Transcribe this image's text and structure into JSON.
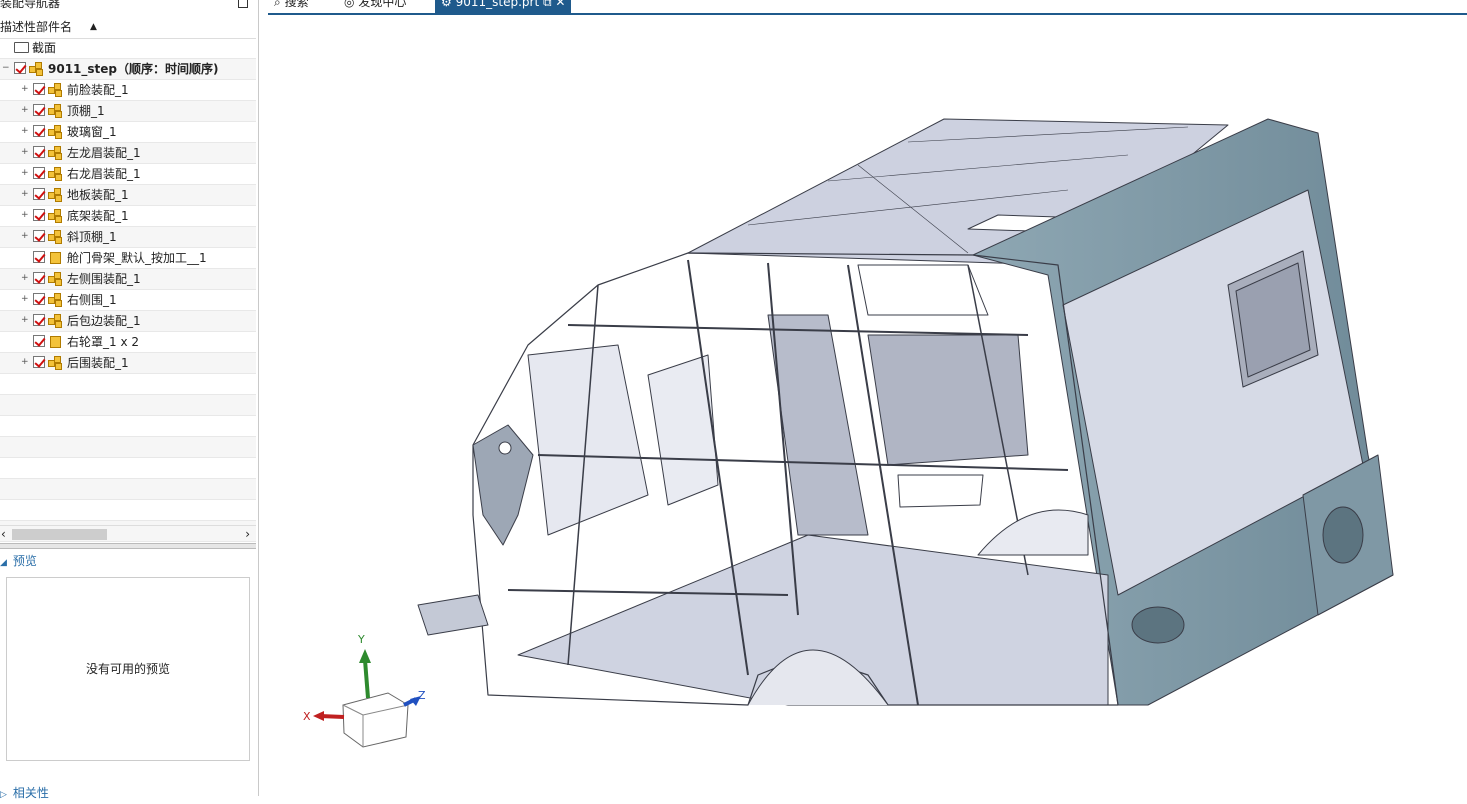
{
  "navigator": {
    "title": "装配导航器",
    "column_header": "描述性部件名",
    "tree": [
      {
        "label": "截面",
        "type": "folder",
        "level": 0
      },
      {
        "label": "9011_step（顺序：时间顺序)",
        "type": "assembly-root",
        "level": 0,
        "bold": true
      },
      {
        "label": "前脸装配_1",
        "type": "assembly",
        "level": 1
      },
      {
        "label": "顶棚_1",
        "type": "assembly",
        "level": 1
      },
      {
        "label": "玻璃窗_1",
        "type": "assembly",
        "level": 1
      },
      {
        "label": "左龙眉装配_1",
        "type": "assembly",
        "level": 1
      },
      {
        "label": "右龙眉装配_1",
        "type": "assembly",
        "level": 1
      },
      {
        "label": "地板装配_1",
        "type": "assembly",
        "level": 1
      },
      {
        "label": "底架装配_1",
        "type": "assembly",
        "level": 1
      },
      {
        "label": "斜顶棚_1",
        "type": "assembly",
        "level": 1
      },
      {
        "label": "舱门骨架_默认_按加工__1",
        "type": "part",
        "level": 1
      },
      {
        "label": "左侧围装配_1",
        "type": "assembly",
        "level": 1
      },
      {
        "label": "右侧围_1",
        "type": "assembly",
        "level": 1
      },
      {
        "label": "后包边装配_1",
        "type": "assembly",
        "level": 1
      },
      {
        "label": "右轮罩_1 x 2",
        "type": "part",
        "level": 1
      },
      {
        "label": "后围装配_1",
        "type": "assembly",
        "level": 1
      }
    ]
  },
  "preview": {
    "header": "预览",
    "empty_message": "没有可用的预览"
  },
  "dependencies": {
    "header": "相关性"
  },
  "tabs": [
    {
      "label": "搜索",
      "icon": "search-icon"
    },
    {
      "label": "发现中心",
      "icon": "discovery-icon"
    },
    {
      "label": "9011_step.prt",
      "icon": "part-file-icon",
      "active": true
    }
  ],
  "triad": {
    "x": "X",
    "y": "Y",
    "z": "Z"
  },
  "colors": {
    "accent": "#1f5a8c",
    "model_body": "#c9cedd",
    "model_trim": "#7d98a6",
    "check": "#d01010"
  }
}
